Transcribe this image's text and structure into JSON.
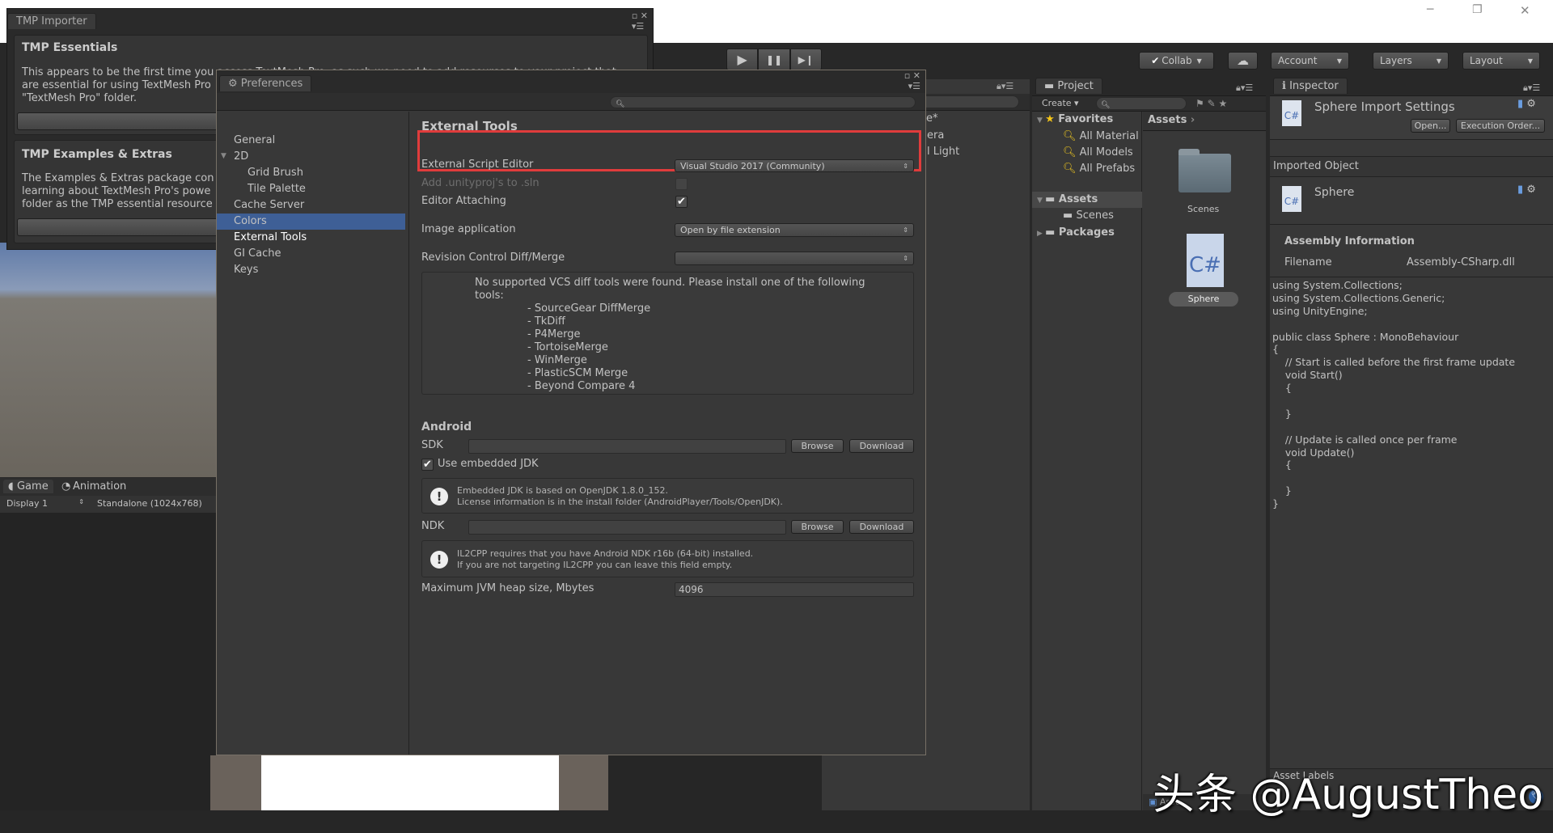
{
  "window_controls": {
    "minimize": "─",
    "restore": "❐",
    "close": "✕"
  },
  "toolbar": {
    "play": "▶",
    "pause": "❚❚",
    "step": "▶❙",
    "collab": "Collab",
    "cloud": "☁",
    "account": "Account",
    "layers": "Layers",
    "layout": "Layout"
  },
  "tmp_importer": {
    "title": "TMP Importer",
    "essentials_title": "TMP Essentials",
    "essentials_lines": [
      "This appears to be the first time you access TextMesh Pro, as such we need to add resources to your project that",
      "are essential for using TextMesh Pro",
      "\"TextMesh Pro\" folder."
    ],
    "extras_title": "TMP Examples & Extras",
    "extras_lines": [
      "The Examples & Extras package con",
      "learning about TextMesh Pro's powe",
      "folder as the TMP essential resource"
    ]
  },
  "game": {
    "tabs": [
      "Game",
      "Animation"
    ],
    "display": "Display 1",
    "resolution": "Standalone (1024x768)"
  },
  "hierarchy": {
    "title_fragment": "e*",
    "items": [
      "era",
      "l Light"
    ]
  },
  "preferences": {
    "title": "Preferences",
    "nav": [
      {
        "label": "General"
      },
      {
        "label": "2D"
      },
      {
        "label": "Grid Brush"
      },
      {
        "label": "Tile Palette"
      },
      {
        "label": "Cache Server"
      },
      {
        "label": "Colors"
      },
      {
        "label": "External Tools",
        "selected": true
      },
      {
        "label": "GI Cache"
      },
      {
        "label": "Keys"
      }
    ],
    "section_title": "External Tools",
    "highlight_color": "#e03c3c",
    "external_script_editor": {
      "label": "External Script Editor",
      "value": "Visual Studio 2017 (Community)"
    },
    "add_unityproj": {
      "label": "Add .unityproj's to .sln",
      "checked": false
    },
    "editor_attaching": {
      "label": "Editor Attaching",
      "checked": true
    },
    "image_application": {
      "label": "Image application",
      "value": "Open by file extension"
    },
    "revision_control": {
      "label": "Revision Control Diff/Merge",
      "value": ""
    },
    "vcs_message": [
      "No supported VCS diff tools were found. Please install one of the following",
      "tools:"
    ],
    "vcs_tools": [
      "- SourceGear DiffMerge",
      "- TkDiff",
      "- P4Merge",
      "- TortoiseMerge",
      "- WinMerge",
      "- PlasticSCM Merge",
      "- Beyond Compare 4"
    ],
    "android": {
      "title": "Android",
      "sdk_label": "SDK",
      "sdk_value": "",
      "browse": "Browse",
      "download": "Download",
      "use_embedded_jdk": "Use embedded JDK",
      "use_embedded_jdk_checked": true,
      "jdk_info": [
        "Embedded JDK is based on OpenJDK 1.8.0_152.",
        "License information is in the install folder (AndroidPlayer/Tools/OpenJDK)."
      ],
      "ndk_label": "NDK",
      "ndk_value": "",
      "ndk_info": [
        "IL2CPP requires that you have Android NDK r16b (64-bit) installed.",
        "If you are not targeting IL2CPP you can leave this field empty."
      ],
      "jvm_label": "Maximum JVM heap size, Mbytes",
      "jvm_value": "4096"
    }
  },
  "project": {
    "title": "Project",
    "create": "Create",
    "favorites": "Favorites",
    "fav_items": [
      "All Material",
      "All Models",
      "All Prefabs"
    ],
    "assets": "Assets",
    "scenes": "Scenes",
    "packages": "Packages",
    "breadcrumb": "Assets",
    "grid_items": [
      "Scenes",
      "Sphere"
    ],
    "asset_partial": "Asse"
  },
  "inspector": {
    "title": "Inspector",
    "asset_title": "Sphere Import Settings",
    "open": "Open...",
    "execution_order": "Execution Order...",
    "imported_object": "Imported Object",
    "object_name": "Sphere",
    "assembly_info": "Assembly Information",
    "filename_label": "Filename",
    "filename_value": "Assembly-CSharp.dll",
    "code": [
      "using System.Collections;",
      "using System.Collections.Generic;",
      "using UnityEngine;",
      "",
      "public class Sphere : MonoBehaviour",
      "{",
      "    // Start is called before the first frame update",
      "    void Start()",
      "    {",
      "",
      "    }",
      "",
      "    // Update is called once per frame",
      "    void Update()",
      "    {",
      "",
      "    }",
      "}"
    ],
    "asset_labels": "Asset Labels"
  },
  "watermark": "头条 @AugustTheo"
}
